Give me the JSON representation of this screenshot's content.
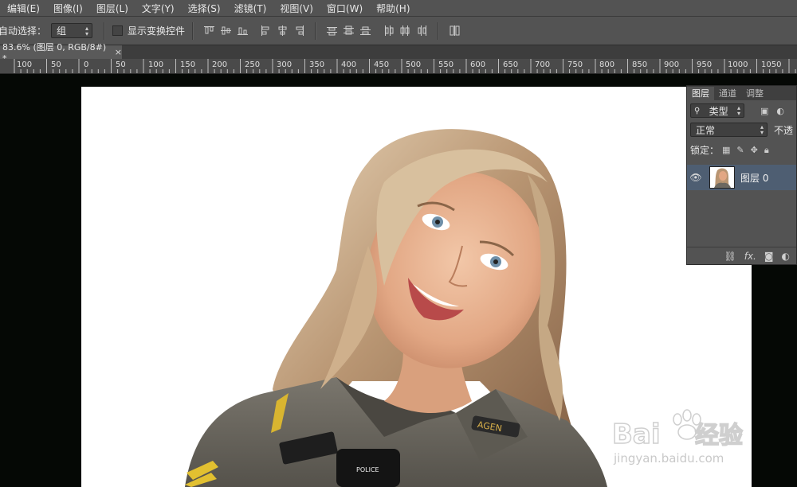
{
  "menubar": {
    "items": [
      "编辑(E)",
      "图像(I)",
      "图层(L)",
      "文字(Y)",
      "选择(S)",
      "滤镜(T)",
      "视图(V)",
      "窗口(W)",
      "帮助(H)"
    ]
  },
  "options": {
    "auto_select_label": "自动选择：",
    "auto_select_value": "组",
    "show_transform_label": "显示变换控件"
  },
  "document": {
    "tab_title": "83.6% (图层 0, RGB/8#) *",
    "close_glyph": "×"
  },
  "ruler": {
    "labels": [
      "100",
      "50",
      "0",
      "50",
      "100",
      "150",
      "200",
      "250",
      "300",
      "350",
      "400",
      "450",
      "500",
      "550",
      "600",
      "650",
      "700",
      "750",
      "800",
      "850",
      "900",
      "950",
      "1000",
      "1050"
    ]
  },
  "layers_panel": {
    "tabs": [
      "图层",
      "通道",
      "调整"
    ],
    "filter_label": "类型",
    "blend_mode": "正常",
    "opacity_label": "不透",
    "lock_label": "锁定：",
    "layer_name": "图层 0",
    "footer_fx": "fx."
  },
  "watermark": {
    "brand": "Bai du 经验",
    "url": "jingyan.baidu.com"
  },
  "colors": {
    "ui_bg": "#535353",
    "canvas_bg": "#050805",
    "layer_selected": "#4e5e72"
  }
}
